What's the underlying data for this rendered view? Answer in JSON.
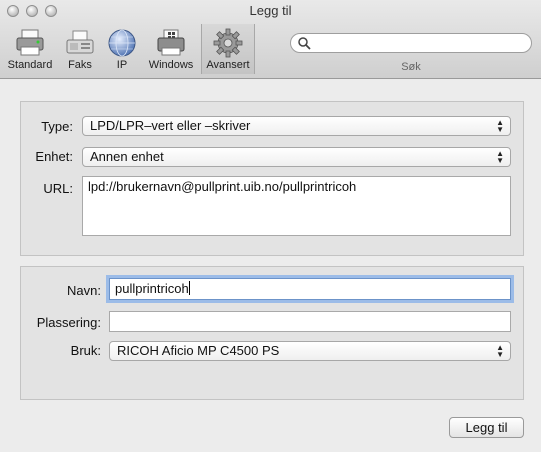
{
  "window": {
    "title": "Legg til"
  },
  "toolbar": {
    "items": [
      {
        "label": "Standard",
        "icon": "printer-icon"
      },
      {
        "label": "Faks",
        "icon": "fax-icon"
      },
      {
        "label": "IP",
        "icon": "globe-icon"
      },
      {
        "label": "Windows",
        "icon": "windows-printer-icon"
      },
      {
        "label": "Avansert",
        "icon": "gear-icon",
        "active": true
      }
    ],
    "search": {
      "value": "",
      "caption": "Søk"
    }
  },
  "connection": {
    "type_label": "Type:",
    "type_value": "LPD/LPR–vert eller –skriver",
    "device_label": "Enhet:",
    "device_value": "Annen enhet",
    "url_label": "URL:",
    "url_value": "lpd://brukernavn@pullprint.uib.no/pullprintricoh"
  },
  "printer": {
    "name_label": "Navn:",
    "name_value": "pullprintricoh",
    "location_label": "Plassering:",
    "location_value": "",
    "use_label": "Bruk:",
    "use_value": "RICOH Aficio MP C4500 PS"
  },
  "footer": {
    "add_label": "Legg til"
  }
}
